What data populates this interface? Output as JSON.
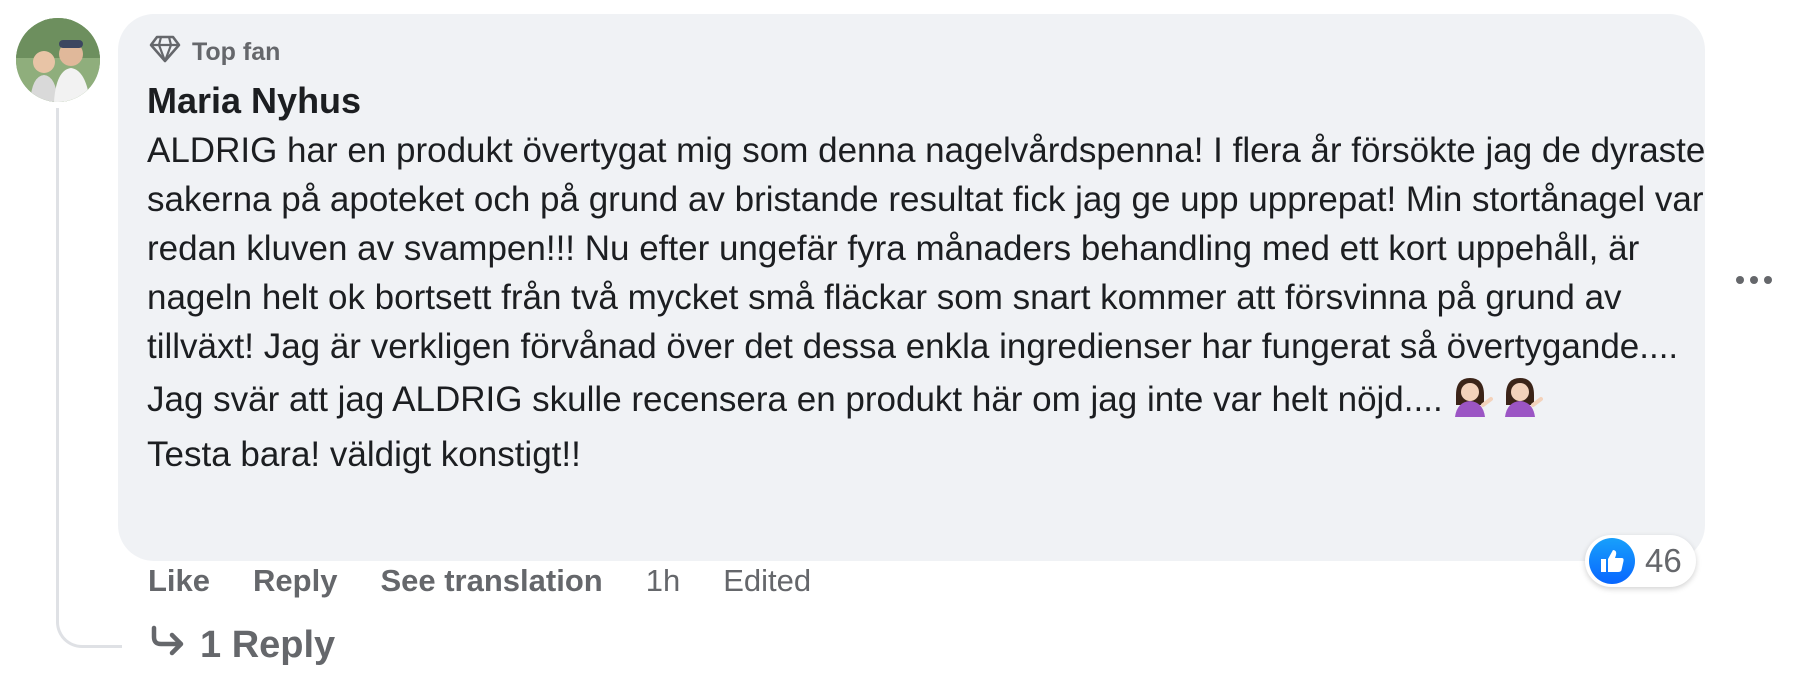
{
  "comment": {
    "badge": "Top fan",
    "author": "Maria Nyhus",
    "text_main": "ALDRIG har en produkt övertygat mig som denna nagelvårdspenna! I flera år försökte jag de dyraste sakerna på apoteket och på grund av bristande resultat fick jag ge upp upprepat! Min stortånagel var redan kluven av svampen!!! Nu efter ungefär fyra månaders behandling med ett kort uppehåll, är nageln helt ok bortsett från två mycket små fläckar som snart kommer att försvinna på grund av tillväxt! Jag är verkligen förvånad över det dessa enkla ingredienser har fungerat så övertygande.... Jag svär att jag ALDRIG skulle recensera en produkt här om jag inte var helt nöjd....",
    "text_last": "Testa bara! väldigt konstigt!!",
    "emojis": [
      "woman-tipping-hand",
      "woman-tipping-hand"
    ]
  },
  "actions": {
    "like": "Like",
    "reply": "Reply",
    "see_translation": "See translation",
    "time": "1h",
    "edited": "Edited"
  },
  "reactions": {
    "count": "46",
    "type": "like-icon",
    "color": "#0866ff"
  },
  "replies": {
    "label": "1 Reply"
  }
}
